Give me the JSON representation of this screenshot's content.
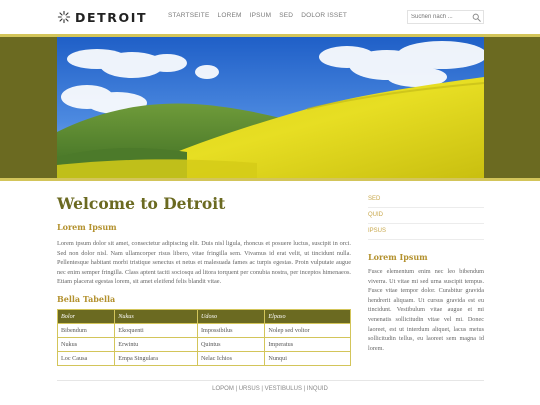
{
  "brand": {
    "name": "DETROIT"
  },
  "nav": {
    "items": [
      "STARTSEITE",
      "LOREM",
      "IPSUM",
      "SED",
      "DOLOR ISSET"
    ]
  },
  "search": {
    "placeholder": "Suchen nach ..."
  },
  "main": {
    "title": "Welcome to Detroit",
    "section_heading": "Lorem Ipsum",
    "paragraph": "Lorem ipsum dolor sit amet, consectetur adipiscing elit. Duis nisl ligula, rhoncus et posuere luctus, suscipit in orci. Sed non dolor nisl. Nam ullamcorper risus libero, vitae fringilla sem. Vivamus id erat velit, ut tincidunt nulla. Pellentesque habitant morbi tristique senectus et netus et malesuada fames ac turpis egestas. Proin vulputate augue nec enim semper fringilla. Class aptent taciti sociosqu ad litora torquent per conubia nostra, per inceptos himenaeos. Etiam placerat egestas lorem, sit amet eleifend felis blandit vitae.",
    "table_heading": "Bella Tabella",
    "table": {
      "headers": [
        "Bolor",
        "Nukus",
        "Udoso",
        "Elpaso"
      ],
      "rows": [
        [
          "Bibendum",
          "Ekoquenti",
          "Impossibilus",
          "Nolep sed voltor"
        ],
        [
          "Nukus",
          "Erwintu",
          "Quintus",
          "Imperatus"
        ],
        [
          "Loc Causa",
          "Empa Singulara",
          "Nelac Ichios",
          "Nunqui"
        ]
      ]
    }
  },
  "sidebar": {
    "links": [
      "SED",
      "QUID",
      "IPSUS"
    ],
    "heading": "Lorem Ipsum",
    "paragraph": "Fusce elementum enim nec leo bibendum viverra. Ut vitae mi sed urna suscipit tempus. Fusce vitae tempor dolor. Curabitur gravida hendrerit aliquam. Ut cursus gravida est eu tincidunt. Vestibulum vitae augue et mi venenatis sollicitudin vitae vel mi. Donec laoreet, est ut interdum aliquet, lacus metus sollicitudin tellus, eu laoreet sem magna id lorem."
  },
  "footer": {
    "text": "LOPOM | URSUS | VESTIBULUS | INQUID"
  },
  "colors": {
    "olive": "#6b6a21",
    "gold": "#d3c55a",
    "heading_gold": "#b3912e"
  },
  "icons": {
    "logo": "sun-burst-icon",
    "search": "magnifier-icon"
  }
}
